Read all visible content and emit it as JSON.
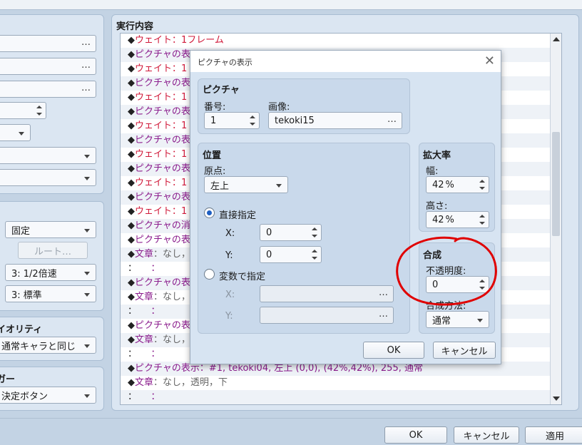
{
  "main": {
    "section_title": "実行内容",
    "events": [
      {
        "mark": "◆",
        "prefix": "ウェイト：1フレーム",
        "rest": "",
        "kind": "wait"
      },
      {
        "mark": "◆",
        "prefix": "ピクチャの表",
        "rest": "",
        "kind": "pic"
      },
      {
        "mark": "◆",
        "prefix": "ウェイト：1",
        "rest": "",
        "kind": "wait"
      },
      {
        "mark": "◆",
        "prefix": "ピクチャの表",
        "rest": "",
        "kind": "pic"
      },
      {
        "mark": "◆",
        "prefix": "ウェイト：1",
        "rest": "",
        "kind": "wait"
      },
      {
        "mark": "◆",
        "prefix": "ピクチャの表",
        "rest": "",
        "kind": "pic"
      },
      {
        "mark": "◆",
        "prefix": "ウェイト：1",
        "rest": "",
        "kind": "wait"
      },
      {
        "mark": "◆",
        "prefix": "ピクチャの表",
        "rest": "",
        "kind": "pic"
      },
      {
        "mark": "◆",
        "prefix": "ウェイト：1",
        "rest": "",
        "kind": "wait"
      },
      {
        "mark": "◆",
        "prefix": "ピクチャの表",
        "rest": "",
        "kind": "pic"
      },
      {
        "mark": "◆",
        "prefix": "ウェイト：1",
        "rest": "",
        "kind": "wait"
      },
      {
        "mark": "◆",
        "prefix": "ピクチャの表",
        "rest": "",
        "kind": "pic"
      },
      {
        "mark": "◆",
        "prefix": "ウェイト：1",
        "rest": "",
        "kind": "wait"
      },
      {
        "mark": "◆",
        "prefix": "ピクチャの消",
        "rest": "",
        "kind": "pic"
      },
      {
        "mark": "◆",
        "prefix": "ピクチャの表",
        "rest": "",
        "kind": "pic"
      },
      {
        "mark": "◆",
        "prefix": "文章",
        "rest": "：なし，",
        "kind": "text"
      },
      {
        "mark": "：",
        "prefix": "",
        "rest": "　　：",
        "kind": "cont"
      },
      {
        "mark": "◆",
        "prefix": "ピクチャの表",
        "rest": "",
        "kind": "pic"
      },
      {
        "mark": "◆",
        "prefix": "文章",
        "rest": "：なし，",
        "kind": "text"
      },
      {
        "mark": "：",
        "prefix": "",
        "rest": "　　：",
        "kind": "cont"
      },
      {
        "mark": "◆",
        "prefix": "ピクチャの表",
        "rest": "",
        "kind": "pic"
      },
      {
        "mark": "◆",
        "prefix": "文章",
        "rest": "：なし，",
        "kind": "text"
      },
      {
        "mark": "：",
        "prefix": "",
        "rest": "　　：",
        "kind": "cont"
      },
      {
        "mark": "◆",
        "prefix": "ピクチャの表示：#1, tekoki04, 左上 (0,0), (42%,42%), 255, 通常",
        "rest": "",
        "kind": "pic"
      },
      {
        "mark": "◆",
        "prefix": "文章",
        "rest": "：なし，透明，下",
        "kind": "text"
      },
      {
        "mark": "：",
        "prefix": "",
        "rest": "　　：",
        "kind": "cont"
      }
    ]
  },
  "left": {
    "dots": "…",
    "fixed_label": "固定",
    "route_button": "ルート…",
    "speed_label": "3: 1/2倍速",
    "freq_label": "3: 標準",
    "priority_title": "イオリティ",
    "priority_value": "通常キャラと同じ",
    "trigger_title": "ガー",
    "trigger_value": "決定ボタン"
  },
  "footer": {
    "ok": "OK",
    "cancel": "キャンセル",
    "apply": "適用"
  },
  "dialog": {
    "title": "ピクチャの表示",
    "close": "✕",
    "picture": {
      "group_title": "ピクチャ",
      "number_label": "番号:",
      "number_value": "1",
      "image_label": "画像:",
      "image_value": "tekoki15",
      "image_dots": "…"
    },
    "position": {
      "group_title": "位置",
      "origin_label": "原点:",
      "origin_value": "左上",
      "direct_label": "直接指定",
      "x_label": "X:",
      "x_value": "0",
      "y_label": "Y:",
      "y_value": "0",
      "var_label": "変数で指定",
      "vx_label": "X:",
      "vy_label": "Y:",
      "vdots": "…"
    },
    "scale": {
      "group_title": "拡大率",
      "width_label": "幅:",
      "width_value": "42",
      "height_label": "高さ:",
      "height_value": "42",
      "unit": "%"
    },
    "blend": {
      "group_title": "合成",
      "opacity_label": "不透明度:",
      "opacity_value": "0",
      "mode_label": "合成方法:",
      "mode_value": "通常"
    },
    "ok": "OK",
    "cancel": "キャンセル"
  },
  "annotation_color": "#e00000"
}
